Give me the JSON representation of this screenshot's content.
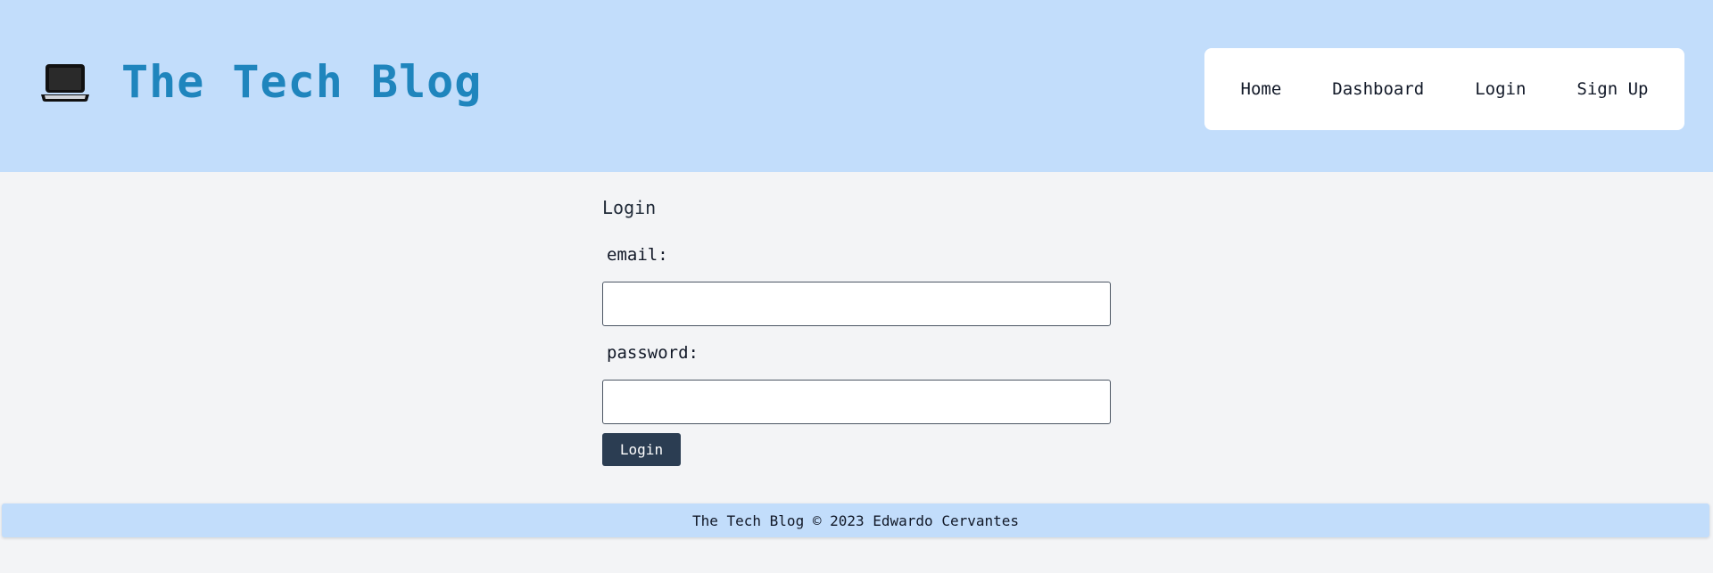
{
  "header": {
    "brand_icon": "laptop-icon",
    "title": "The Tech Blog",
    "nav": {
      "home": "Home",
      "dashboard": "Dashboard",
      "login": "Login",
      "signup": "Sign Up"
    }
  },
  "login_form": {
    "title": "Login",
    "email_label": "email:",
    "email_value": "",
    "password_label": "password:",
    "password_value": "",
    "submit_label": "Login"
  },
  "footer": {
    "text": "The Tech Blog © 2023 Edwardo Cervantes"
  },
  "colors": {
    "header_bg": "#c2ddfb",
    "title_color": "#1f85bd",
    "button_bg": "#2b3d52",
    "page_bg": "#f3f4f6"
  }
}
